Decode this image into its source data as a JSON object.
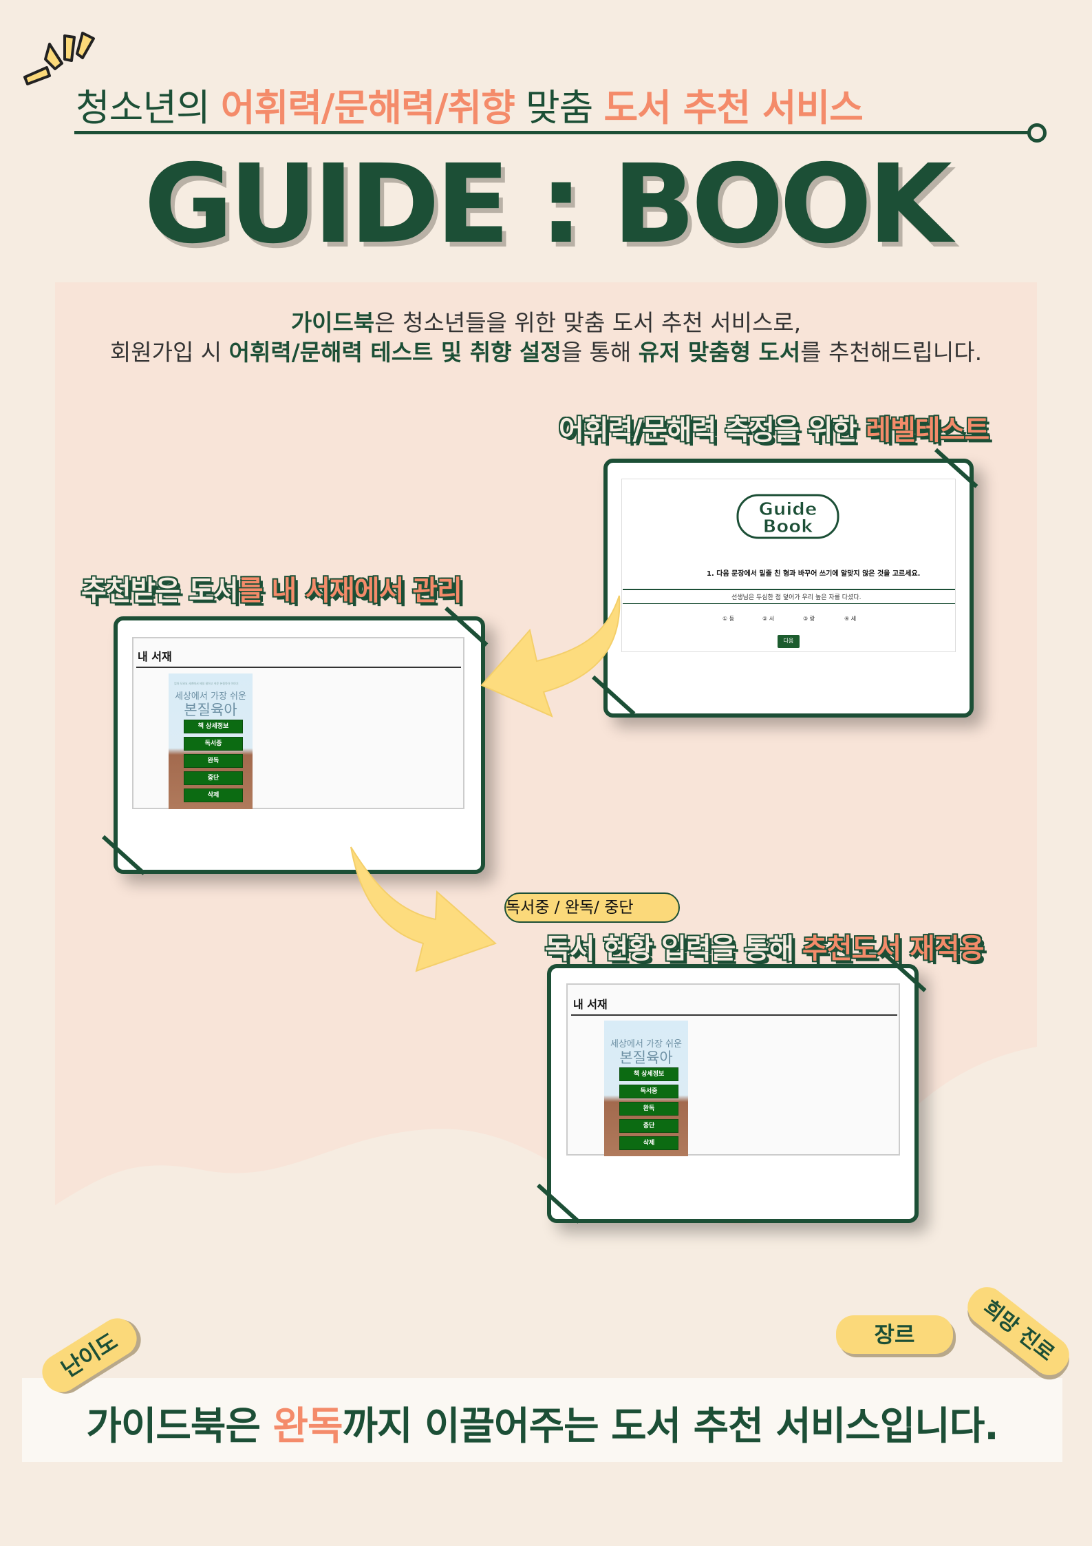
{
  "header": {
    "subtitle": {
      "part1": "청소년의 ",
      "part2": "어휘력/문해력/취향",
      "part3": " 맞춤 ",
      "part4": "도서 추천 서비스"
    },
    "title": "GUIDE : BOOK"
  },
  "intro": {
    "line1_bold": "가이드북",
    "line1_rest": "은 청소년들을 위한 맞춤 도서 추천 서비스로,",
    "line2_a": "회원가입 시 ",
    "line2_b": "어휘력/문해력 테스트 및 취향 설정",
    "line2_c": "을 통해 ",
    "line2_d": "유저 맞춤형 도서",
    "line2_e": "를 추천해드립니다."
  },
  "sections": {
    "level_test": {
      "a": "어휘력/문해력 ",
      "b": "측정을 위한 ",
      "c": "레벨테스트"
    },
    "shelf": {
      "a": "추천받은 도서",
      "b": "를 ",
      "c": "내 서재에서 관리"
    },
    "status": {
      "a": "독서 현황 입력",
      "b": "을 통해 ",
      "c": "추천도서 재적용"
    }
  },
  "level_test_card": {
    "logo_line1": "Guide",
    "logo_line2": "Book",
    "question": "1. 다음 문장에서 밑줄 친 형과 바꾸어 쓰기에 알맞지 않은 것을 고르세요.",
    "sentence": "선생님은 두심한 점 덮어가 우리 높은 자를 다셨다.",
    "options": [
      "① 등",
      "② 서",
      "③ 랑",
      "④ 세"
    ],
    "next_button": "다음"
  },
  "bookshelf": {
    "title": "내 서재",
    "book_small_text": "엄마 도와요 세계에서 제일 잘하고 쉬운 본질육아 이야기",
    "book_line1": "세상에서 가장 쉬운",
    "book_line2": "본질육아",
    "buttons": [
      "책 상세정보",
      "독서중",
      "완독",
      "중단",
      "삭제"
    ]
  },
  "status_bubble": "독서중 / 완독/ 중단",
  "tags": {
    "difficulty": "난이도",
    "genre": "장르",
    "career": "희망 진로"
  },
  "footer": {
    "a": "가이드북은 ",
    "b": "완독",
    "c": "까지 이끌어주는 도서 추천 서비스입니다."
  },
  "colors": {
    "green": "#1c4f36",
    "coral": "#f48b6a",
    "yellow": "#fbd97a",
    "background": "#f6ece1",
    "panel": "#f8e4d8"
  }
}
